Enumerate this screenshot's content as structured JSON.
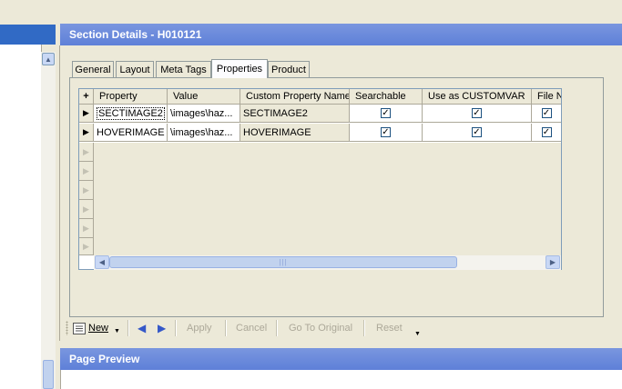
{
  "section_header": {
    "title": "Section Details - H010121"
  },
  "tabs": [
    {
      "label": "General",
      "active": false
    },
    {
      "label": "Layout",
      "active": false
    },
    {
      "label": "Meta Tags",
      "active": false
    },
    {
      "label": "Properties",
      "active": true
    },
    {
      "label": "Product",
      "active": false
    }
  ],
  "grid": {
    "add_row_label": "+",
    "columns": [
      "Property",
      "Value",
      "Custom Property Name",
      "Searchable",
      "Use as CUSTOMVAR",
      "File N"
    ],
    "rows": [
      {
        "property": "SECTIMAGE2",
        "value": "\\images\\haz...",
        "custom_name": "SECTIMAGE2",
        "searchable": true,
        "customvar": true,
        "file": true
      },
      {
        "property": "HOVERIMAGE",
        "value": "\\images\\haz...",
        "custom_name": "HOVERIMAGE",
        "searchable": true,
        "customvar": true,
        "file": true
      }
    ],
    "row_indicator": "▶",
    "scroll_thumb_grip": "|||"
  },
  "toolbar": {
    "new_label": "New",
    "apply_label": "Apply",
    "cancel_label": "Cancel",
    "goto_original_label": "Go To Original",
    "reset_label": "Reset"
  },
  "preview_header": {
    "title": "Page Preview"
  },
  "colors": {
    "header_blue": "#6A8ADB",
    "selection_blue": "#316AC5",
    "panel_bg": "#ECE9D8",
    "nav_arrow": "#3558C8"
  },
  "icons": {
    "new": "document-list-icon",
    "dropdown": "dropdown-arrow-icon",
    "prev": "left-arrow-icon",
    "next": "right-arrow-icon",
    "check": "checkmark-icon",
    "scroll_up": "scroll-up-icon",
    "scroll_left": "scroll-left-icon",
    "scroll_right": "scroll-right-icon"
  }
}
